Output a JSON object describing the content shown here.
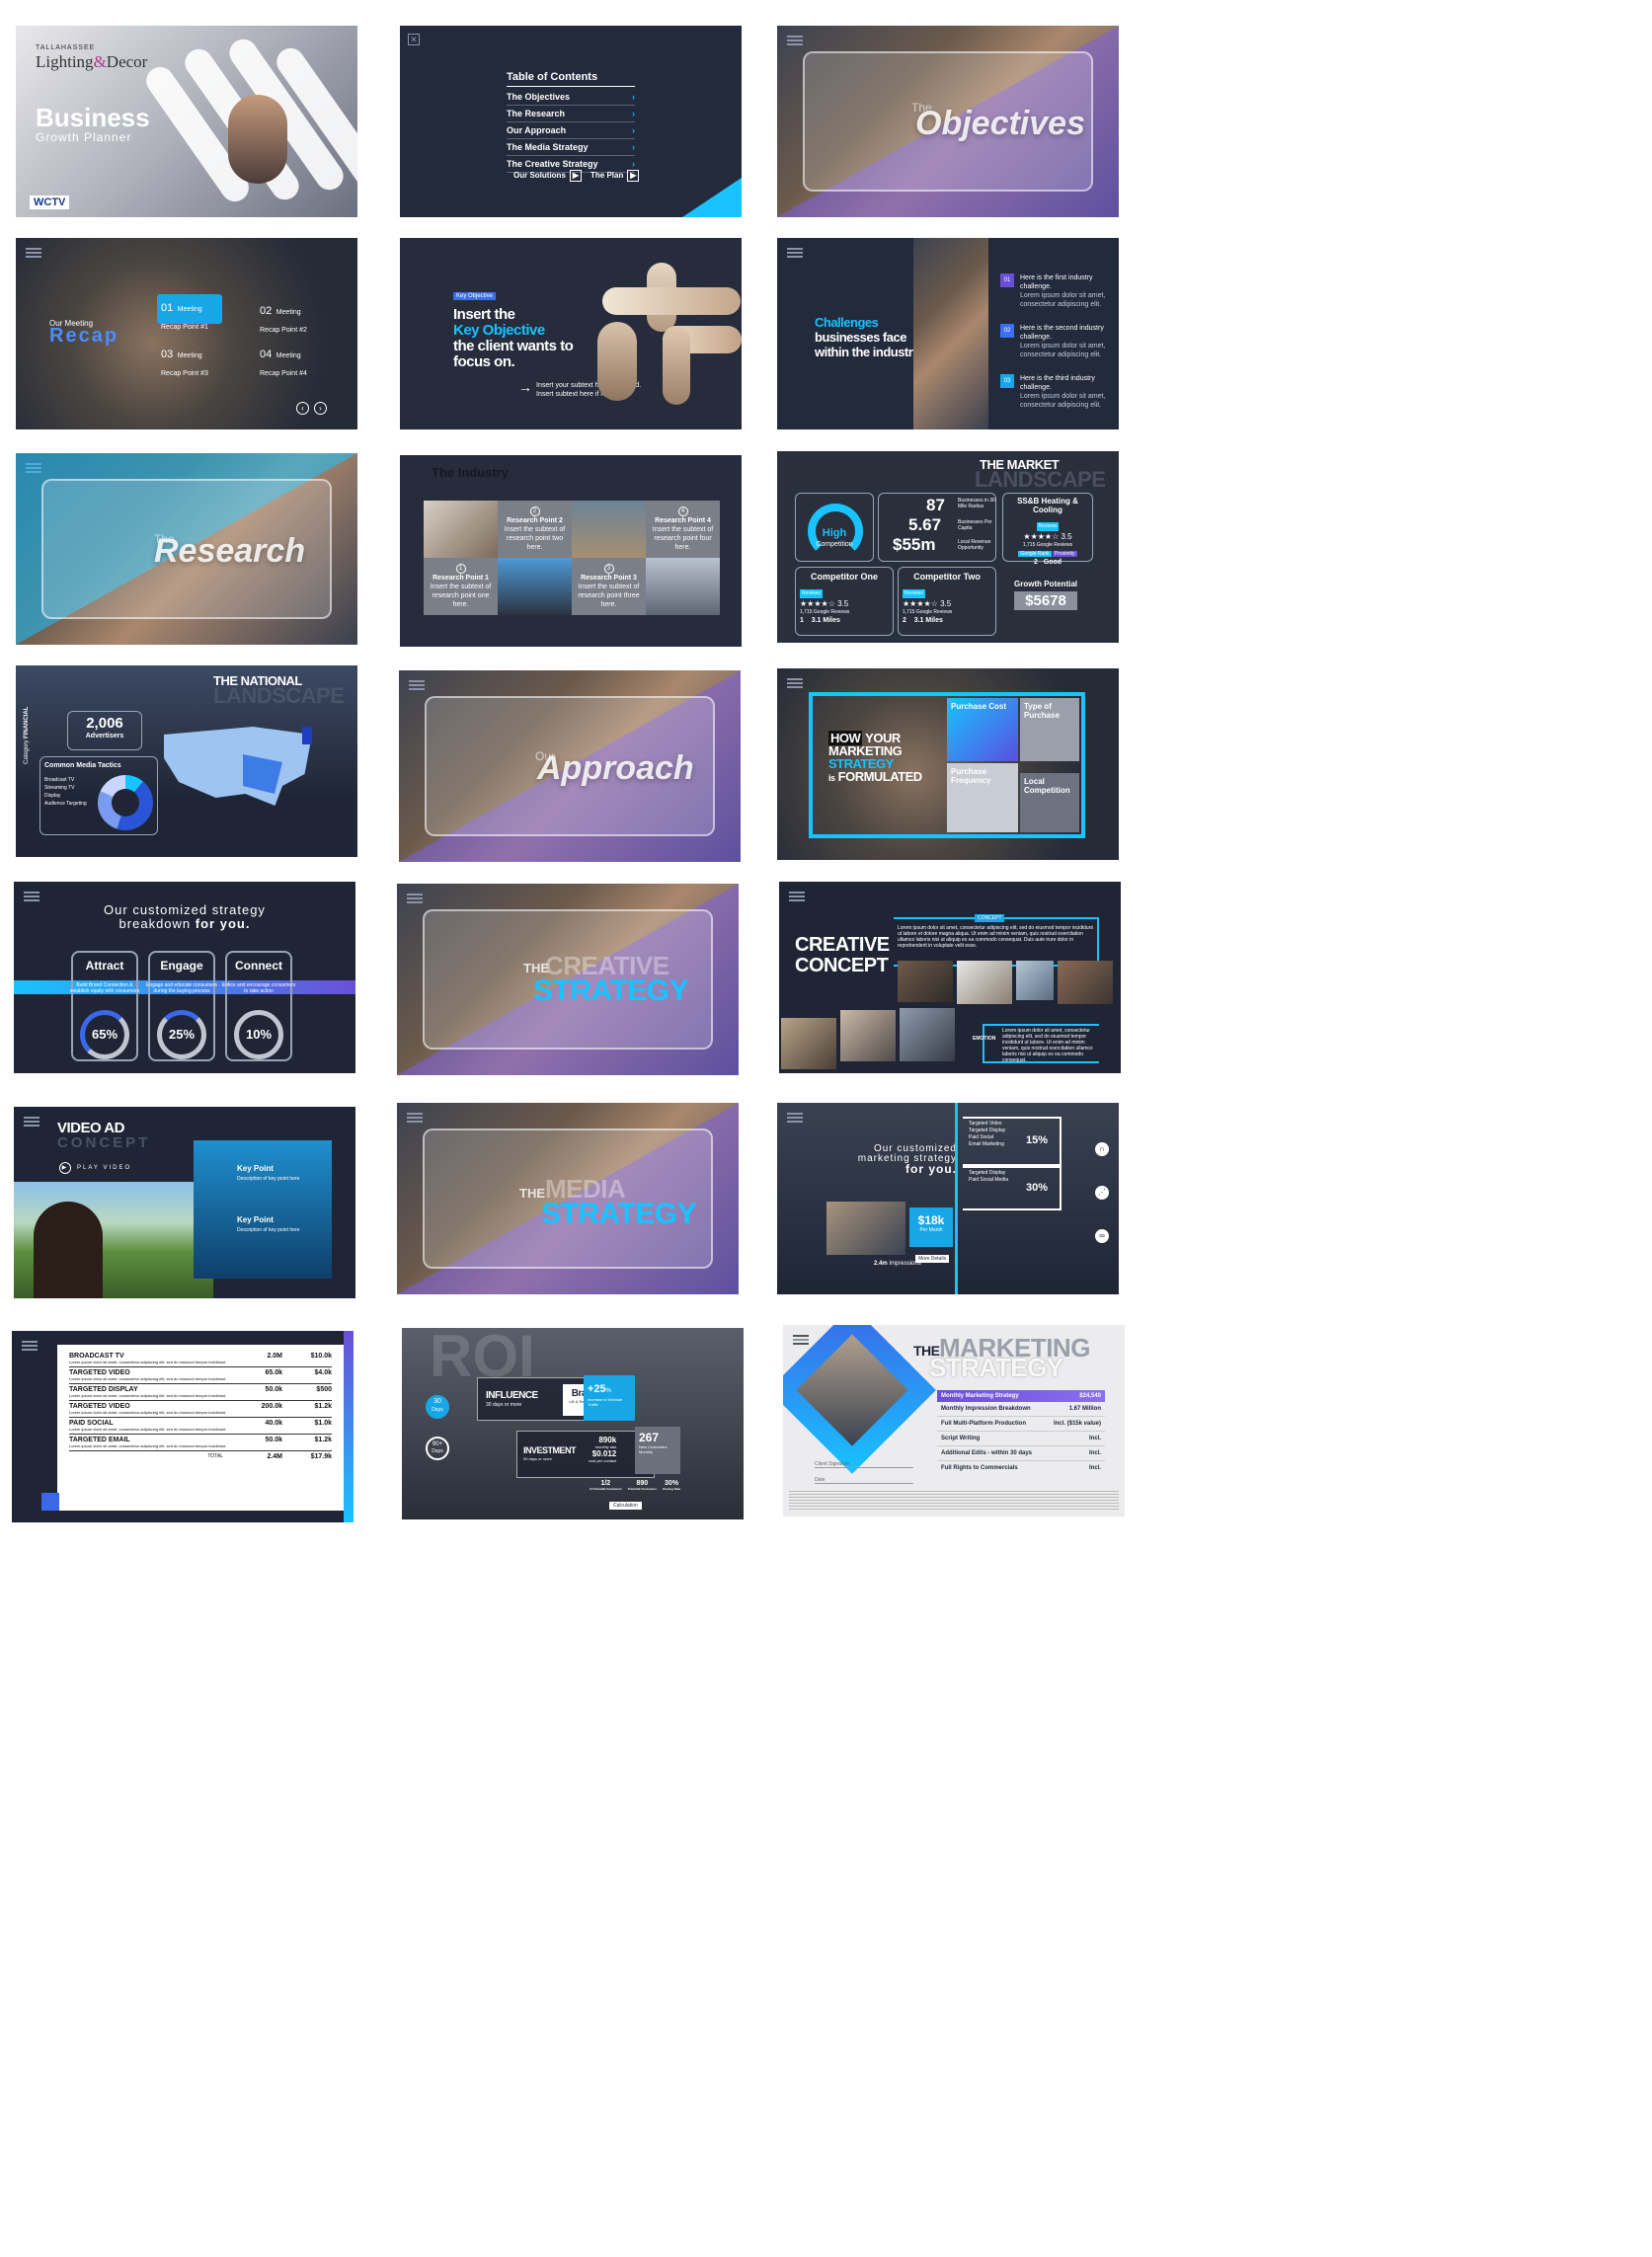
{
  "colors": {
    "accent": "#18c3ff",
    "navy": "#1f2535",
    "purple": "#7b5fe0"
  },
  "s1": {
    "brand_top": "TALLAHASSEE",
    "brand_main": "Lighting",
    "brand_amp": "&",
    "brand_end": "Decor",
    "title": "Business",
    "subtitle": "Growth Planner",
    "logo": "WCTV"
  },
  "s2": {
    "title": "Table of Contents",
    "items": [
      "The Objectives",
      "The Research",
      "Our Approach",
      "The Media Strategy",
      "The Creative Strategy"
    ],
    "btn1": "Our Solutions",
    "btn2": "The Plan"
  },
  "s3": {
    "pre": "The",
    "word": "Objectives"
  },
  "s4": {
    "pre": "Our Meeting",
    "title": "Recap",
    "points": [
      {
        "num": "01",
        "label": "Meeting Recap Point #1"
      },
      {
        "num": "02",
        "label": "Meeting Recap Point #2"
      },
      {
        "num": "03",
        "label": "Meeting Recap Point #3"
      },
      {
        "num": "04",
        "label": "Meeting Recap Point #4"
      }
    ]
  },
  "s5": {
    "tag": "Key Objective",
    "l1": "Insert the",
    "l2": "Key Objective",
    "l3": "the client wants to",
    "l4": "focus on.",
    "sub1": "Insert your subtext here if needed.",
    "sub2": "Insert subtext here if needed."
  },
  "s6": {
    "h1": "Challenges",
    "h2": "businesses face",
    "h3": "within the industry.",
    "items": [
      {
        "num": "01",
        "title": "Here is the first industry challenge.",
        "body": "Lorem ipsum dolor sit amet, consectetur adipiscing elit."
      },
      {
        "num": "02",
        "title": "Here is the second industry challenge.",
        "body": "Lorem ipsum dolor sit amet, consectetur adipiscing elit."
      },
      {
        "num": "03",
        "title": "Here is the third industry challenge.",
        "body": "Lorem ipsum dolor sit amet, consectetur adipiscing elit."
      }
    ]
  },
  "s7": {
    "pre": "The",
    "word": "Research"
  },
  "s8": {
    "title": "The Industry",
    "points": [
      {
        "num": "2",
        "title": "Research Point 2",
        "body": "Insert the subtext of research point two here."
      },
      {
        "num": "4",
        "title": "Research Point 4",
        "body": "Insert the subtext of research point four here."
      },
      {
        "num": "1",
        "title": "Research Point 1",
        "body": "Insert the subtext of research point one here."
      },
      {
        "num": "3",
        "title": "Research Point 3",
        "body": "Insert the subtext of research point three here."
      }
    ]
  },
  "s9": {
    "t1": "THE MARKET",
    "t2": "LANDSCAPE",
    "gauge": "High",
    "gauge_sub": "Competition",
    "n1": "87",
    "n1l": "Businesses in 30-Mile Radius",
    "n2": "5.67",
    "n2l": "Businesses Per Capita",
    "n3": "$55m",
    "n3l": "Local Revenue Opportunity",
    "c0": "SS&B Heating & Cooling",
    "reviews": "Reviews",
    "stars": "★★★★☆",
    "rating": "3.5",
    "greviews": "1,715 Google Reviews",
    "grank": "Google Rank",
    "prox": "Proximity",
    "c0rank": "2",
    "c0prox": "Good",
    "c1": "Competitor One",
    "c2": "Competitor Two",
    "c1rank": "1",
    "c2rank": "2",
    "miles": "3.1 Miles",
    "gp": "Growth Potential",
    "gpv": "$5678"
  },
  "s10": {
    "t1": "THE NATIONAL",
    "t2": "LANDSCAPE",
    "cat": "FINANCIAL",
    "cat_pre": "Category",
    "num": "2,006",
    "numl": "Advertisers",
    "tactics": "Common Media Tactics",
    "legend": [
      "Broadcast TV",
      "Streaming TV",
      "Display",
      "Audience Targeting"
    ],
    "d1": "11.1%",
    "d2": "44%",
    "d3": "27.2%"
  },
  "s11": {
    "pre": "Our",
    "word": "Approach"
  },
  "s12": {
    "how": "HOW",
    "your": "YOUR",
    "l2": "MARKETING",
    "l3": "STRATEGY",
    "l4": "is",
    "l5": "FORMULATED",
    "b1": "Purchase Cost",
    "b2": "Type of Purchase",
    "b3": "Purchase Frequency",
    "b4": "Local Competition"
  },
  "s13": {
    "h1": "Our customized strategy",
    "h2": "breakdown",
    "h3": "for you.",
    "cards": [
      {
        "t": "Attract",
        "d": "Build Brand Connection & establish equity with consumers",
        "p": "65%"
      },
      {
        "t": "Engage",
        "d": "Engage and educate consumers during the buying process",
        "p": "25%"
      },
      {
        "t": "Connect",
        "d": "Entice and encourage consumers to take action",
        "p": "10%"
      }
    ]
  },
  "s14": {
    "pre": "THE",
    "word": "CREATIVE",
    "word2": "STRATEGY"
  },
  "s15": {
    "t1": "CREATIVE",
    "t2": "CONCEPT",
    "tag": "CONCEPT",
    "body": "Lorem ipsum dolor sit amet, consectetur adipiscing elit, sed do eiusmod tempor incididunt ut labore et dolore magna aliqua. Ut enim ad minim veniam, quis nostrud exercitation ullamco laboris nisi ut aliquip ex ea commodo consequat. Duis aute irure dolor in reprehenderit in voluptate velit esse.",
    "tag2": "EMOTION",
    "body2": "Lorem ipsum dolor sit amet, consectetur adipiscing elit, sed do eiusmod tempor incididunt ut labore. Ut enim ad minim veniam, quis nostrud exercitation ullamco laboris nisi ut aliquip ex ea commodo consequat."
  },
  "s16": {
    "t1": "VIDEO AD",
    "t2": "CONCEPT",
    "play": "PLAY VIDEO",
    "kp": "Key Point",
    "kpd": "Description of key point here"
  },
  "s17": {
    "pre": "THE",
    "word": "MEDIA",
    "word2": "STRATEGY"
  },
  "s18": {
    "h1": "Our customized",
    "h2": "marketing strategy",
    "h3": "for you.",
    "g1": [
      "Targeted Video",
      "Targeted Display",
      "Paid Social",
      "Email Marketing"
    ],
    "p1": "15%",
    "g2": [
      "Targeted Display",
      "Paid Social Media"
    ],
    "p2": "30%",
    "price": "$18k",
    "per": "Per Month",
    "imp": "2.4m",
    "impl": "Impressions",
    "more": "More Details"
  },
  "s19": {
    "rows": [
      {
        "t": "BROADCAST TV",
        "i": "2.0M",
        "c": "$10.0k"
      },
      {
        "t": "TARGETED VIDEO",
        "i": "65.0k",
        "c": "$4.0k"
      },
      {
        "t": "TARGETED DISPLAY",
        "i": "50.0k",
        "c": "$500"
      },
      {
        "t": "TARGETED VIDEO",
        "i": "200.0k",
        "c": "$1.2k"
      },
      {
        "t": "PAID SOCIAL",
        "i": "40.0k",
        "c": "$1.0k"
      },
      {
        "t": "TARGETED EMAIL",
        "i": "50.0k",
        "c": "$1.2k"
      }
    ],
    "total": "TOTAL",
    "ti": "2.4M",
    "tc": "$17.9k",
    "desc": "Lorem ipsum dolor sit amet, consectetur adipiscing elit, sed do eiusmod tempor incididunt."
  },
  "s20": {
    "bg": "ROI",
    "d30": "30",
    "d30l": "Days",
    "d90": "90+",
    "d90l": "Days",
    "inf": "INFLUENCE",
    "infl": "30 days or more",
    "brand": "Brand",
    "brandl": "Lift & Recognition",
    "pct": "+25",
    "pcts": "%",
    "pctl": "Increase in Website Traffic",
    "inv": "INVESTMENT",
    "invl": "90 days or more",
    "m1": "890k",
    "m1l": "monthly ads",
    "m2": "$0.012",
    "m2l": "cost per contact",
    "big": "267",
    "bigl": "New Customers Monthly",
    "f1": "1/2",
    "f1l": "% Potential Customers",
    "f2": "890",
    "f2l": "Potential Customers",
    "f3": "30%",
    "f3l": "Closing Rate",
    "calc": "Calculation"
  },
  "s21": {
    "the": "THE",
    "w1": "MARKETING",
    "w2": "STRATEGY",
    "rows": [
      {
        "t": "Monthly Marketing Strategy",
        "v": "$24,540"
      },
      {
        "t": "Monthly Impression Breakdown",
        "v": "1.67 Million"
      },
      {
        "t": "Full Multi-Platform Production",
        "v": "Incl. ($15k value)"
      },
      {
        "t": "Script Writing",
        "v": "Incl."
      },
      {
        "t": "Additional Edits - within 30 days",
        "v": "Incl."
      },
      {
        "t": "Full Rights to Commercials",
        "v": "Incl."
      }
    ],
    "sig": "Client Signature",
    "date": "Date"
  }
}
